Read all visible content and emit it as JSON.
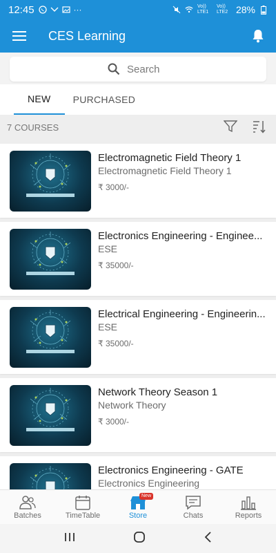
{
  "status_bar": {
    "time": "12:45",
    "dots": "···",
    "lte1": "Vo)) LTE1",
    "lte2": "Vo)) LTE2",
    "battery": "28%"
  },
  "app": {
    "title": "CES Learning"
  },
  "search": {
    "placeholder": "Search"
  },
  "tabs": [
    {
      "label": "NEW",
      "active": true
    },
    {
      "label": "PURCHASED",
      "active": false
    }
  ],
  "courses_count_label": "7 COURSES",
  "courses": [
    {
      "title": "Electromagnetic Field Theory 1",
      "subtitle": "Electromagnetic Field Theory 1",
      "price": "₹ 3000/-"
    },
    {
      "title": "Electronics Engineering  - Enginee...",
      "subtitle": "ESE",
      "price": "₹ 35000/-"
    },
    {
      "title": "Electrical Engineering - Engineerin...",
      "subtitle": "ESE",
      "price": "₹ 35000/-"
    },
    {
      "title": "Network Theory Season 1",
      "subtitle": "Network Theory",
      "price": "₹ 3000/-"
    },
    {
      "title": "Electronics Engineering - GATE",
      "subtitle": "Electronics Engineering",
      "price": ""
    }
  ],
  "thumbnail_text": "CENTRE FOR ENGINEERING STUDIES",
  "bottom_nav": [
    {
      "label": "Batches",
      "icon": "batches-icon",
      "active": false
    },
    {
      "label": "TimeTable",
      "icon": "calendar-icon",
      "active": false
    },
    {
      "label": "Store",
      "icon": "store-icon",
      "active": true,
      "badge": "New"
    },
    {
      "label": "Chats",
      "icon": "chat-icon",
      "active": false
    },
    {
      "label": "Reports",
      "icon": "reports-icon",
      "active": false
    }
  ],
  "colors": {
    "primary": "#1e90d8",
    "badge": "#d9342b",
    "text": "#222222",
    "muted": "#6b6b6b"
  }
}
